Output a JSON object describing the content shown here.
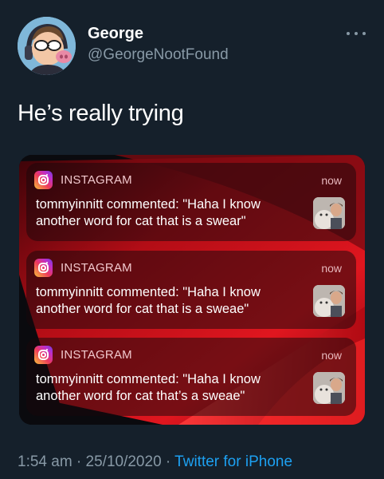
{
  "author": {
    "display_name": "George",
    "handle": "@GeorgeNootFound"
  },
  "tweet": {
    "text": "He’s really trying"
  },
  "notifications": [
    {
      "app": "INSTAGRAM",
      "time": "now",
      "message": "tommyinnitt commented: \"Haha I know another word for cat that is a swear\""
    },
    {
      "app": "INSTAGRAM",
      "time": "now",
      "message": "tommyinnitt commented: \"Haha I know another word for cat that is a sweae\""
    },
    {
      "app": "INSTAGRAM",
      "time": "now",
      "message": "tommyinnitt commented: \"Haha I know another word for cat that’s a sweae\""
    }
  ],
  "footer": {
    "timestamp": "1:54 am · 25/10/2020 · ",
    "source": "Twitter for iPhone"
  },
  "icons": {
    "more": "more-dots-icon",
    "app": "instagram-icon"
  },
  "colors": {
    "background": "#15202b",
    "secondary_text": "#8899a6",
    "link": "#1da1f2"
  }
}
